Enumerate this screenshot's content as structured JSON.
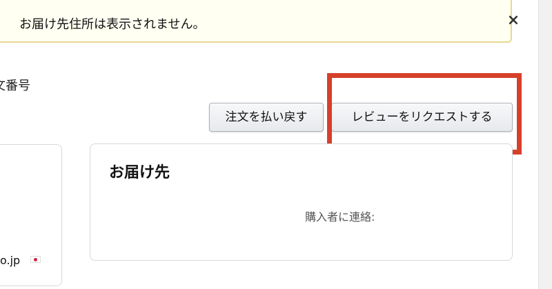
{
  "alert": {
    "message": "お届け先住所は表示されません。",
    "close_label": "×"
  },
  "order": {
    "label": "文番号"
  },
  "actions": {
    "refund_label": "注文を払い戻す",
    "review_label": "レビューをリクエストする"
  },
  "buyer_card": {
    "email_fragment": "o.jp"
  },
  "shipping_card": {
    "title": "お届け先",
    "contact_label": "購入者に連絡:"
  },
  "colors": {
    "alert_border": "#e9d88f",
    "alert_bg": "#fffff2",
    "highlight": "#d6402b",
    "flag_red": "#d31e3a"
  }
}
